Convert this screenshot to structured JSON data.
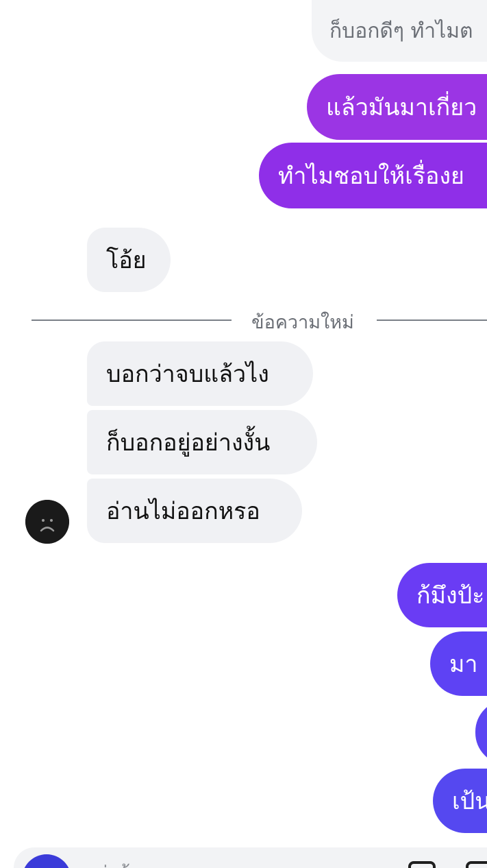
{
  "chat": {
    "quoted_reply": "ก็บอกดีๆ ทำไมต",
    "messages_top": [
      {
        "text": "แล้วมันมาเกี่ยว",
        "color": "#9b35e4"
      },
      {
        "text": "ทำไมชอบให้เรื่องย",
        "color": "#8f2fe8"
      }
    ],
    "reply_single": "โอ้ย",
    "divider_label": "ข้อความใหม่",
    "received": [
      "บอกว่าจบแล้วไง",
      "ก็บอกอยู่อย่างงั้น",
      "อ่านไม่ออกหรอ"
    ],
    "sent_bottom": [
      {
        "text": "ก้มึงป้ะ",
        "color": "#6a3cf4"
      },
      {
        "text": "มา",
        "color": "#5e42f4"
      },
      {
        "text": "",
        "color": "#5b45f2"
      },
      {
        "text": "เป้น",
        "color": "#5548f0"
      }
    ]
  },
  "avatar": {
    "icon": "sad-face-icon"
  },
  "composer": {
    "placeholder": "ส่งข้อ",
    "accent": "#3b3bd9"
  },
  "colors": {
    "received_bg": "#f0f1f4",
    "divider": "#7a7f87"
  }
}
